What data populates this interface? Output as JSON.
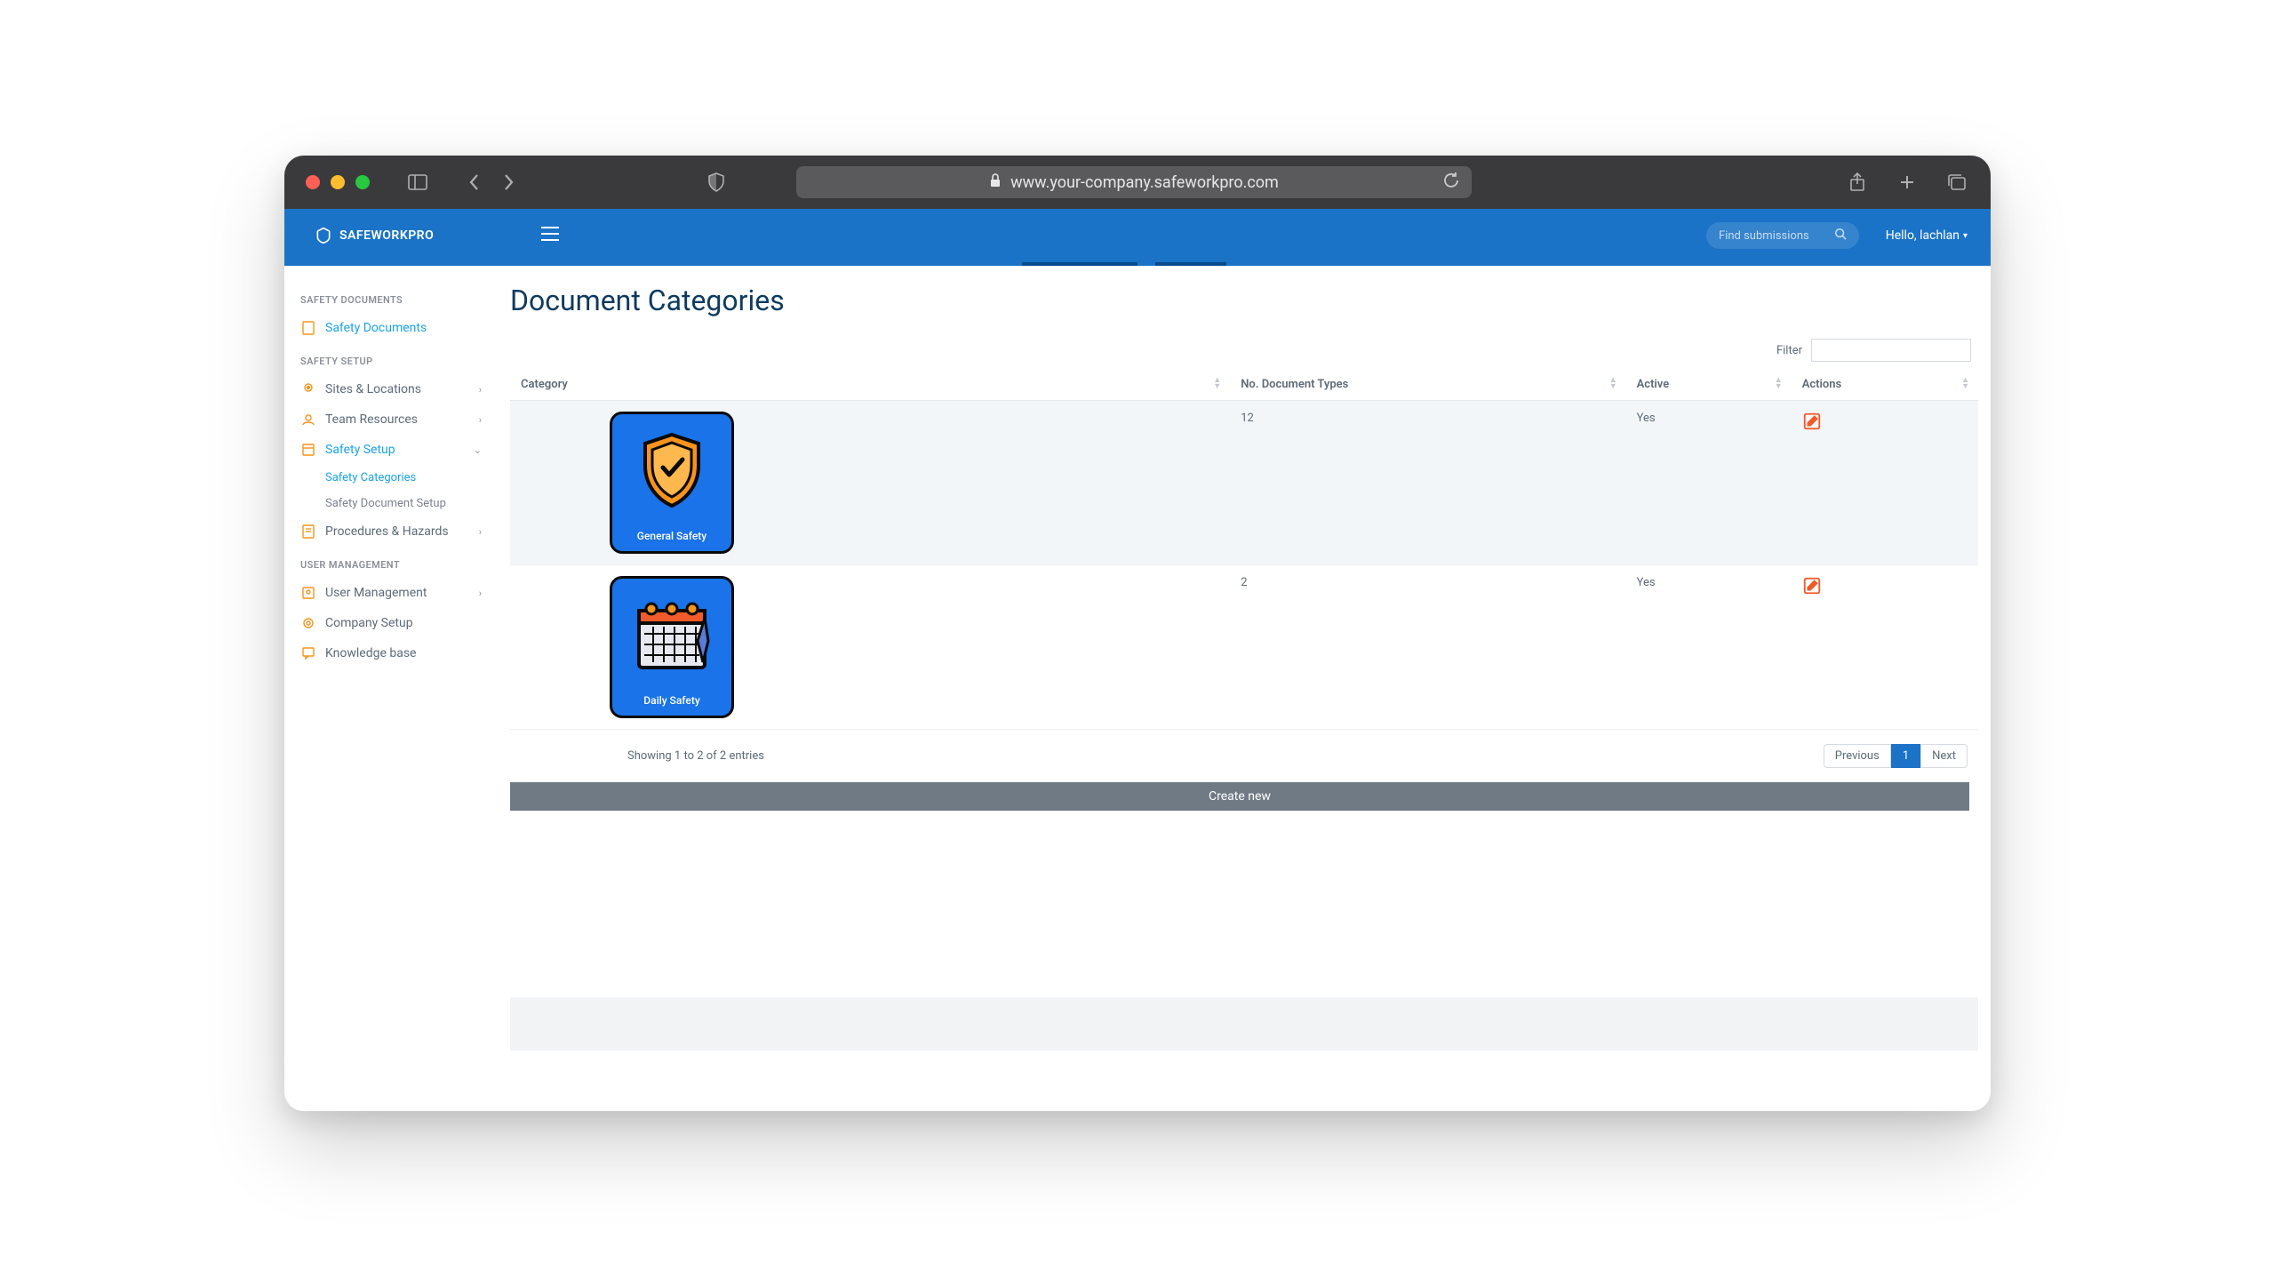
{
  "browser": {
    "url": "www.your-company.safeworkpro.com"
  },
  "header": {
    "brand": "SAFEWORKPRO",
    "search_placeholder": "Find submissions",
    "greeting": "Hello, lachlan"
  },
  "sidebar": {
    "sections": [
      {
        "label": "SAFETY DOCUMENTS",
        "items": [
          {
            "label": "Safety Documents",
            "icon": "document-icon",
            "active": true
          }
        ]
      },
      {
        "label": "SAFETY SETUP",
        "items": [
          {
            "label": "Sites & Locations",
            "icon": "pin-icon",
            "chevron": true
          },
          {
            "label": "Team Resources",
            "icon": "team-icon",
            "chevron": true
          },
          {
            "label": "Safety Setup",
            "icon": "setup-icon",
            "chevron": true,
            "active": true,
            "expanded": true,
            "children": [
              {
                "label": "Safety Categories",
                "active": true
              },
              {
                "label": "Safety Document Setup"
              }
            ]
          },
          {
            "label": "Procedures & Hazards",
            "icon": "hazard-icon",
            "chevron": true
          }
        ]
      },
      {
        "label": "USER MANAGEMENT",
        "items": [
          {
            "label": "User Management",
            "icon": "user-icon",
            "chevron": true
          },
          {
            "label": "Company Setup",
            "icon": "gear-icon"
          },
          {
            "label": "Knowledge base",
            "icon": "chat-icon"
          }
        ]
      }
    ]
  },
  "page": {
    "title": "Document Categories",
    "filter_label": "Filter",
    "columns": [
      "Category",
      "No. Document Types",
      "Active",
      "Actions"
    ],
    "rows": [
      {
        "category_name": "General Safety",
        "icon": "shield",
        "doc_types": "12",
        "active": "Yes"
      },
      {
        "category_name": "Daily Safety",
        "icon": "calendar",
        "doc_types": "2",
        "active": "Yes"
      }
    ],
    "entries_text": "Showing 1 to 2 of 2 entries",
    "pager": {
      "prev": "Previous",
      "next": "Next",
      "current": "1"
    },
    "create_label": "Create new"
  }
}
